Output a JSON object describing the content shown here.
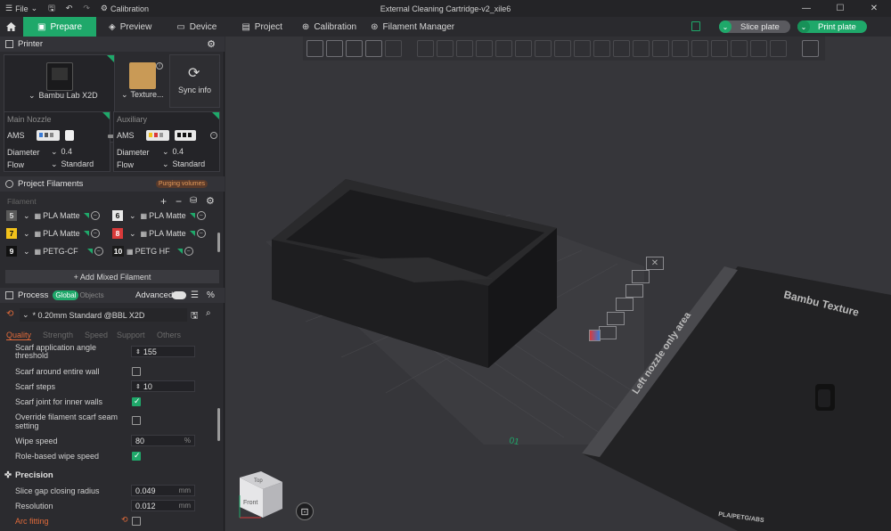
{
  "titlebar": {
    "file_label": "File",
    "calibration_label": "Calibration",
    "window_title": "External Cleaning Cartridge-v2_xile6",
    "minimize": "—",
    "maximize": "☐",
    "close": "✕"
  },
  "tabs": [
    {
      "label": "Prepare",
      "icon": "cube-icon"
    },
    {
      "label": "Preview",
      "icon": "layers-icon"
    },
    {
      "label": "Device",
      "icon": "monitor-icon"
    },
    {
      "label": "Project",
      "icon": "folder-icon"
    },
    {
      "label": "Calibration",
      "icon": "target-icon"
    },
    {
      "label": "Filament Manager",
      "icon": "spool-icon"
    }
  ],
  "actions": {
    "slice_label": "Slice plate",
    "print_label": "Print plate"
  },
  "printer": {
    "section_title": "Printer",
    "name": "Bambu Lab X2D",
    "plate": "Texture...",
    "sync": "Sync info"
  },
  "nozzles": {
    "main_title": "Main Nozzle",
    "aux_title": "Auxiliary",
    "ams_label": "AMS",
    "diameter_label": "Diameter",
    "flow_label": "Flow",
    "main_diameter": "0.4",
    "main_flow": "Standard",
    "aux_diameter": "0.4",
    "aux_flow": "Standard"
  },
  "filaments": {
    "section_title": "Project Filaments",
    "purging_label": "Purging volumes",
    "filter_placeholder": "Filament",
    "items": [
      {
        "num": "5",
        "name": "PLA Matte",
        "color": "#5a5a5a",
        "text": "#ddd"
      },
      {
        "num": "6",
        "name": "PLA Matte",
        "color": "#e8e8e8",
        "text": "#111"
      },
      {
        "num": "7",
        "name": "PLA Matte",
        "color": "#f2c21b",
        "text": "#111"
      },
      {
        "num": "8",
        "name": "PLA Matte",
        "color": "#d93a3a",
        "text": "#fff"
      },
      {
        "num": "9",
        "name": "PETG-CF",
        "color": "#111111",
        "text": "#fff"
      },
      {
        "num": "10",
        "name": "PETG HF",
        "color": "#1a1a1a",
        "text": "#fff"
      }
    ],
    "add_mixed": "+ Add Mixed Filament"
  },
  "process": {
    "section_title": "Process",
    "global_label": "Global",
    "objects_label": "Objects",
    "advanced_label": "Advanced",
    "profile": "* 0.20mm Standard @BBL X2D",
    "tabs": [
      "Quality",
      "Strength",
      "Speed",
      "Support",
      "Others"
    ],
    "settings": [
      {
        "label": "Scarf application angle threshold",
        "value": "155",
        "type": "spin"
      },
      {
        "label": "Scarf around entire wall",
        "type": "check",
        "checked": false
      },
      {
        "label": "Scarf steps",
        "value": "10",
        "type": "spin"
      },
      {
        "label": "Scarf joint for inner walls",
        "type": "check",
        "checked": true
      },
      {
        "label": "Override filament scarf seam setting",
        "type": "check",
        "checked": false
      },
      {
        "label": "Wipe speed",
        "value": "80",
        "unit": "%",
        "type": "input"
      },
      {
        "label": "Role-based wipe speed",
        "type": "check",
        "checked": true
      }
    ],
    "precision_title": "Precision",
    "precision": [
      {
        "label": "Slice gap closing radius",
        "value": "0.049",
        "unit": "mm"
      },
      {
        "label": "Resolution",
        "value": "0.012",
        "unit": "mm"
      },
      {
        "label": "Arc fitting",
        "type": "check",
        "checked": false
      }
    ]
  },
  "viewport": {
    "plate_label": "01",
    "left_nozzle_text": "Left nozzle only area",
    "bambu_texture_text": "Bambu Texture",
    "plate_brand_text": "PLA/PETG/ABS",
    "cube_top": "Top",
    "cube_front": "Front"
  }
}
